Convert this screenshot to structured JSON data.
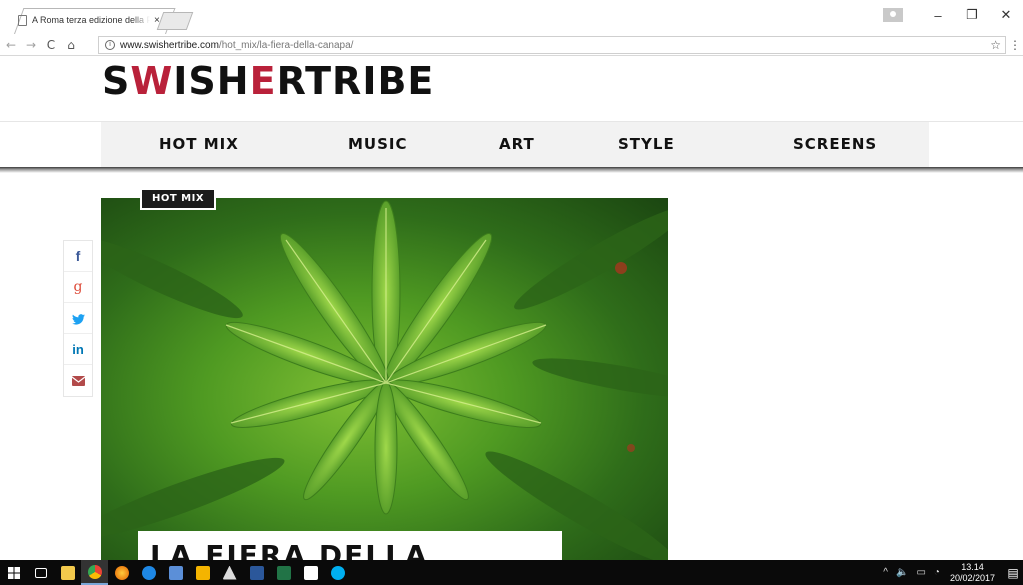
{
  "browser": {
    "tab_title": "A Roma terza edizione della Fiera della Canapa",
    "tab_close": "×",
    "url_host": "www.swishertribe.com",
    "url_path": "/hot_mix/la-fiera-della-canapa/",
    "window_controls": {
      "minimize": "–",
      "maximize": "❐",
      "close": "✕"
    },
    "nav": {
      "back": "←",
      "forward": "→",
      "reload": "C",
      "home": "⌂"
    },
    "bookmark": "☆",
    "menu": "⋮"
  },
  "site": {
    "logo_part1": "S",
    "logo_accent": "W",
    "logo_part2": "ISH",
    "logo_accent2": "E",
    "logo_part3": "RTRIBE",
    "accent_color": "#b9213a",
    "nav": [
      {
        "label": "HOT MIX"
      },
      {
        "label": "MUSIC"
      },
      {
        "label": "ART"
      },
      {
        "label": "STYLE"
      },
      {
        "label": "SCREENS"
      }
    ]
  },
  "article": {
    "category_badge": "HOT MIX",
    "title": "LA FIERA DELLA CANAPA",
    "share": [
      {
        "icon": "facebook-icon",
        "glyph": "f",
        "color": "#3b5998"
      },
      {
        "icon": "google-plus-icon",
        "glyph": "g",
        "color": "#dd4b39"
      },
      {
        "icon": "twitter-icon",
        "glyph": "t",
        "color": "#1da1f2"
      },
      {
        "icon": "linkedin-icon",
        "glyph": "in",
        "color": "#0077b5"
      },
      {
        "icon": "email-icon",
        "glyph": "✉",
        "color": "#b24a4a"
      }
    ]
  },
  "taskbar": {
    "time": "13.14",
    "date": "20/02/2017",
    "tray_symbols": {
      "chevron": "^",
      "volume": "🔈",
      "network": "▭",
      "wifi": "◔"
    },
    "notifications": "▤"
  }
}
